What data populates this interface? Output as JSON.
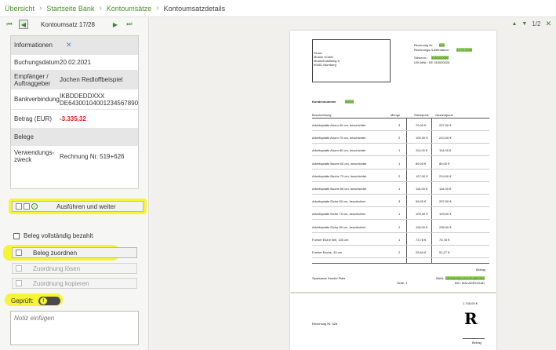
{
  "breadcrumb": [
    "Übersicht",
    "Startseite Bank",
    "Kontoumsätze",
    "Kontoumsatzdetails"
  ],
  "nav": {
    "label": "Kontoumsatz 17/28"
  },
  "info": {
    "rows": [
      {
        "label": "Informationen",
        "value": ""
      },
      {
        "label": "Buchungsdatum",
        "value": "20.02.2021"
      },
      {
        "label": "Empfänger / Auftraggeber",
        "value": "Jochen Redloffbeispiel"
      },
      {
        "label": "Bankverbindung",
        "value": "IKBDDEDDXXX DE64300104001234567890"
      },
      {
        "label": "Betrag (EUR)",
        "value": "-3.335,32"
      },
      {
        "label": "Belege",
        "value": ""
      },
      {
        "label": "Verwendungs-zweck",
        "value": "Rechnung Nr. 519+626"
      }
    ]
  },
  "buttons": {
    "execute": "Ausführen und weiter",
    "belegFull": "Beleg vollständig bezahlt",
    "assign": "Beleg zuordnen",
    "release": "Zuordnung lösen",
    "copy": "Zuordnung kopieren"
  },
  "geprueft": "Geprüft:",
  "notePlaceholder": "Notiz einfügen",
  "viewer": {
    "pageInfo": "1/2"
  },
  "invoice": {
    "company": "Firma",
    "addr1": "Muster GmbH",
    "addr2": "Musterhobelweg 5",
    "addr3": "90451 Nürnberg",
    "rnLabel": "Rechnung Nr.",
    "rnValue": "626",
    "dateLabel": "Rechnungs-/Lieferdatum:",
    "dateValue": "01.02.2020",
    "taxLabel": "Steuernr.:",
    "taxValue": "9181000000",
    "ustLabel": "USt-IdNr.: DE 915000026",
    "kundeLabel": "Kundennummer",
    "kundeValue": "40000",
    "headers": [
      "Beschreibung",
      "Menge",
      "Stückpreis",
      "Gesamtpreis"
    ],
    "items": [
      {
        "d": "Arbeitsplatte Ahorn 60 cm, beschichtet",
        "q": "3",
        "p": "79,00 €",
        "t": "237,00 €"
      },
      {
        "d": "Arbeitsplatte Ahorn 70 cm, beschichtet",
        "q": "2",
        "p": "105,00 €",
        "t": "210,00 €"
      },
      {
        "d": "Arbeitsplatte Ahorn 80 cm, beschichtet",
        "q": "1",
        "p": "114,00 €",
        "t": "114,00 €"
      },
      {
        "d": "Arbeitsplatte Buche 60 cm, beschichtet",
        "q": "1",
        "p": "89,00 €",
        "t": "89,00 €"
      },
      {
        "d": "Arbeitsplatte Buche 70 cm, beschichtet",
        "q": "2",
        "p": "107,00 €",
        "t": "214,00 €"
      },
      {
        "d": "Arbeitsplatte Buche 80 cm, beschichtet",
        "q": "1",
        "p": "116,00 €",
        "t": "116,00 €"
      },
      {
        "d": "Arbeitsplatte Eiche 60 cm, beschichtet",
        "q": "3",
        "p": "99,00 €",
        "t": "297,00 €"
      },
      {
        "d": "Arbeitsplatte Eiche 70 cm, beschichtet",
        "q": "1",
        "p": "109,00 €",
        "t": "109,00 €"
      },
      {
        "d": "Arbeitsplatte Eiche 80 cm, beschichtet",
        "q": "2",
        "p": "118,00 €",
        "t": "236,00 €"
      },
      {
        "d": "Furnier Eiche hell, 100 cm",
        "q": "1",
        "p": "73,78 €",
        "t": "73,78 €"
      },
      {
        "d": "Furnier Esche, 40 cm",
        "q": "2",
        "p": "25,64 €",
        "t": "51,27 €"
      }
    ],
    "betrag": "Betrag",
    "bank": "Sparkasse Kandel Platz",
    "ibanLabel": "IBAN:",
    "ibanValue": "DE52545514401234567890",
    "bic": "BIC: MALADE51KAD",
    "seite": "Seite: 1"
  },
  "page2": {
    "amount": "1.748,05 €",
    "rn": "Rechnung Nr. 626",
    "logo": "R",
    "betrag": "Betrag"
  }
}
